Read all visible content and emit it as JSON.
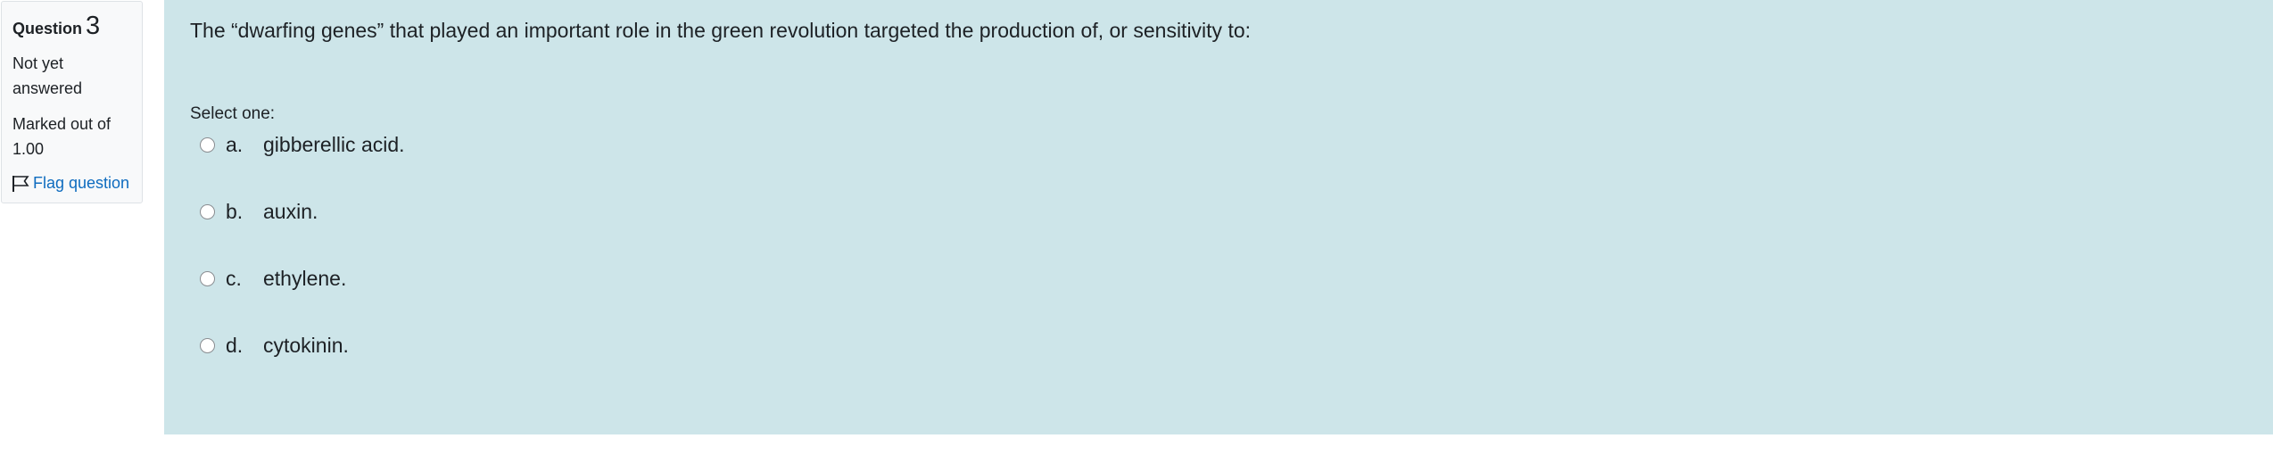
{
  "info": {
    "question_label": "Question",
    "question_number": "3",
    "state": "Not yet answered",
    "grade": "Marked out of 1.00",
    "flag_label": "Flag question"
  },
  "question": {
    "text": "The “dwarfing genes” that played an important role in the green revolution targeted the production of, or sensitivity to:",
    "prompt": "Select one:",
    "options": [
      {
        "letter": "a.",
        "text": "gibberellic acid."
      },
      {
        "letter": "b.",
        "text": "auxin."
      },
      {
        "letter": "c.",
        "text": "ethylene."
      },
      {
        "letter": "d.",
        "text": "cytokinin."
      }
    ]
  },
  "colors": {
    "content_bg": "#cde5e9",
    "info_bg": "#f8f9fa",
    "link": "#0f6cbf"
  }
}
